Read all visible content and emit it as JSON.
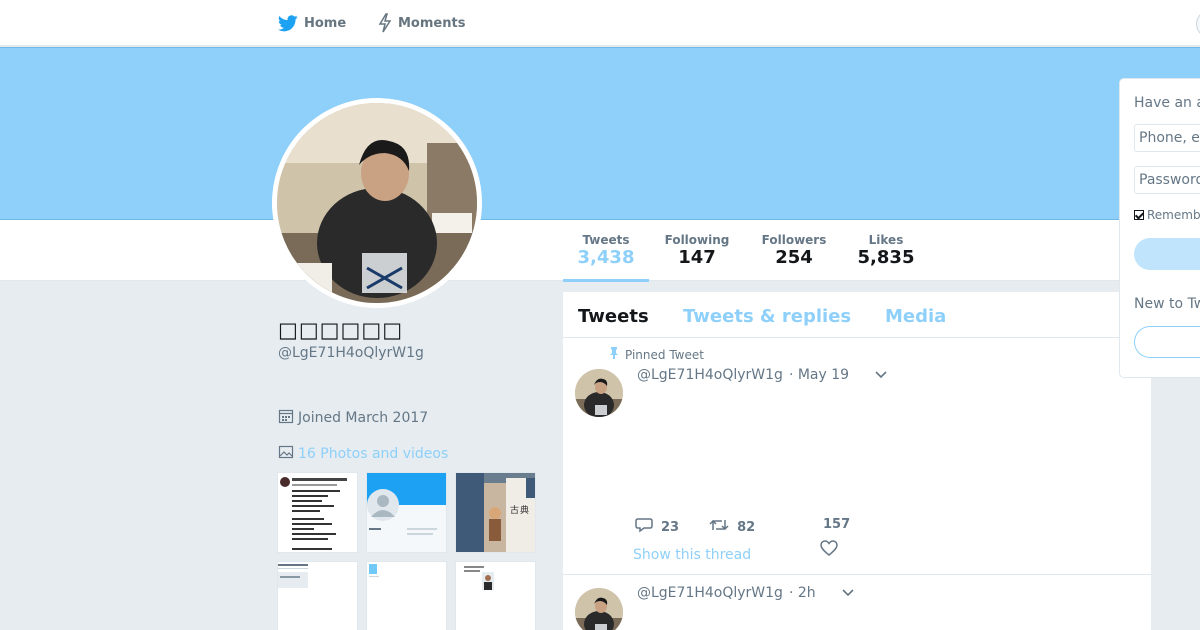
{
  "nav": {
    "home_label": "Home",
    "moments_label": "Moments",
    "home_icon": "twitter-bird-icon",
    "moments_icon": "lightning-icon"
  },
  "colors": {
    "accent": "#8ed0f9",
    "text_secondary": "#657786",
    "background": "#e6ecf0"
  },
  "stats": {
    "tweets_label": "Tweets",
    "tweets_value": "3,438",
    "following_label": "Following",
    "following_value": "147",
    "followers_label": "Followers",
    "followers_value": "254",
    "likes_label": "Likes",
    "likes_value": "5,835"
  },
  "profile": {
    "name": "□□□□□□",
    "handle": "@LgE71H4oQlyrW1g",
    "joined": "Joined March 2017",
    "photos_link": "16 Photos and videos"
  },
  "timeline": {
    "tab_tweets": "Tweets",
    "tab_replies": "Tweets & replies",
    "tab_media": "Media",
    "tweets": [
      {
        "pinned_label": "Pinned Tweet",
        "handle": "@LgE71H4oQlyrW1g",
        "time": "· May 19",
        "replies": "23",
        "retweets": "82",
        "likes": "157",
        "show_thread": "Show this thread"
      },
      {
        "handle": "@LgE71H4oQlyrW1g",
        "time": "· 2h"
      }
    ]
  },
  "login": {
    "title": "Have an a",
    "phone_placeholder": "Phone, e",
    "password_placeholder": "Password",
    "remember_label": "Rememb",
    "new_to_twitter": "New to Tw"
  }
}
